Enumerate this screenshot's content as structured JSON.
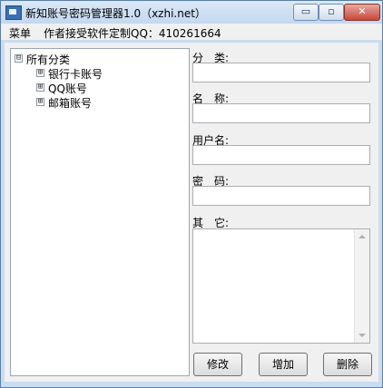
{
  "window": {
    "title": "新知账号密码管理器1.0（xzhi.net）",
    "controls": {
      "minimize": "▭",
      "maximize": "▫",
      "close": "✕"
    }
  },
  "menubar": {
    "menu_label": "菜单",
    "info_text": "作者接受软件定制QQ：410261664"
  },
  "tree": {
    "root": {
      "label": "所有分类",
      "expander": "⊟"
    },
    "children": [
      {
        "label": "银行卡账号",
        "expander": "⊞"
      },
      {
        "label": "QQ账号",
        "expander": "⊞"
      },
      {
        "label": "邮箱账号",
        "expander": "⊞"
      }
    ]
  },
  "form": {
    "category_label": "分　类:",
    "name_label": "名　称:",
    "username_label": "用户名:",
    "password_label": "密　码:",
    "other_label": "其　它:",
    "category_value": "",
    "name_value": "",
    "username_value": "",
    "password_value": "",
    "other_value": ""
  },
  "buttons": {
    "edit": "修改",
    "add": "增加",
    "delete": "删除"
  }
}
